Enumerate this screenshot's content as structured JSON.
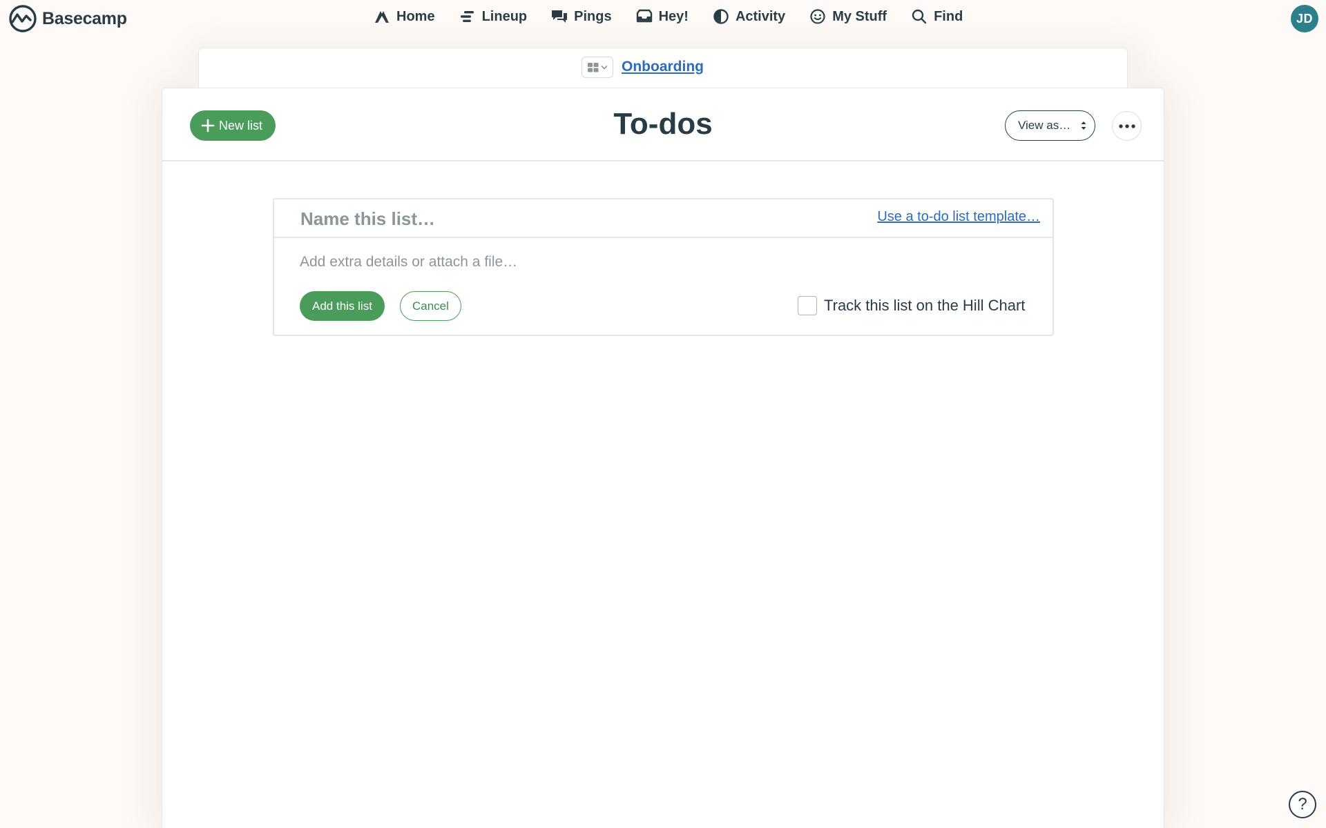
{
  "app": {
    "name": "Basecamp",
    "logo_icon": "basecamp-logo-icon"
  },
  "nav": {
    "items": [
      {
        "label": "Home",
        "icon": "home-icon"
      },
      {
        "label": "Lineup",
        "icon": "lineup-icon"
      },
      {
        "label": "Pings",
        "icon": "pings-icon"
      },
      {
        "label": "Hey!",
        "icon": "inbox-icon"
      },
      {
        "label": "Activity",
        "icon": "activity-icon"
      },
      {
        "label": "My Stuff",
        "icon": "smiley-icon"
      },
      {
        "label": "Find",
        "icon": "search-icon"
      }
    ],
    "avatar_initials": "JD",
    "avatar_color": "#2d7f8b"
  },
  "project": {
    "name": "Onboarding",
    "switcher_icon": "grid-icon"
  },
  "page": {
    "title": "To-dos",
    "new_list_label": "New list",
    "view_as_label": "View as…",
    "more_icon": "ellipsis-icon"
  },
  "form": {
    "name_placeholder": "Name this list…",
    "name_value": "",
    "template_link": "Use a to-do list template…",
    "details_placeholder": "Add extra details or attach a file…",
    "details_value": "",
    "add_button": "Add this list",
    "cancel_button": "Cancel",
    "hill_chart_label": "Track this list on the Hill Chart",
    "hill_chart_checked": false
  },
  "help": {
    "label": "?"
  },
  "colors": {
    "accent_green": "#4a9c5b",
    "link_blue": "#2c6bbd",
    "text": "#283c46",
    "background": "#fdfaf7"
  }
}
